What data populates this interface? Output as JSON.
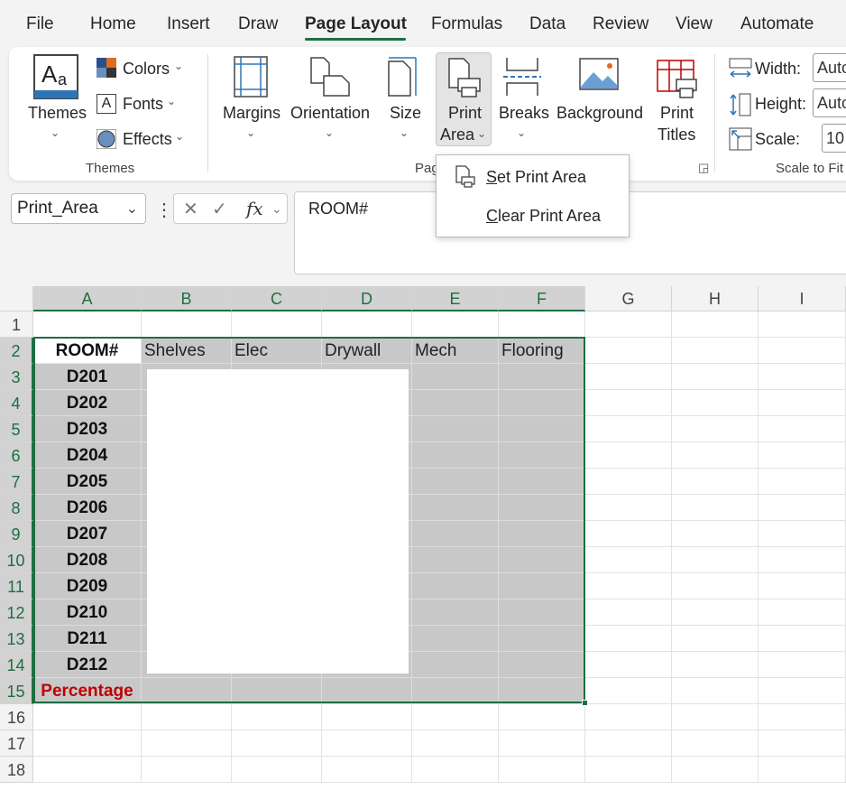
{
  "menu": {
    "tabs": [
      "File",
      "Home",
      "Insert",
      "Draw",
      "Page Layout",
      "Formulas",
      "Data",
      "Review",
      "View",
      "Automate"
    ],
    "active_tab": "Page Layout"
  },
  "ribbon": {
    "themes_group": {
      "themes_label": "Themes",
      "colors_label": "Colors",
      "fonts_label": "Fonts",
      "effects_label": "Effects",
      "group_label": "Themes"
    },
    "page_setup_group": {
      "margins_label": "Margins",
      "orientation_label": "Orientation",
      "size_label": "Size",
      "print_area_line1": "Print",
      "print_area_line2": "Area",
      "breaks_label": "Breaks",
      "background_label": "Background",
      "print_titles_line1": "Print",
      "print_titles_line2": "Titles",
      "group_label_visible": "Pag"
    },
    "scale_group": {
      "width_label": "Width:",
      "width_value": "Auto",
      "height_label": "Height:",
      "height_value": "Auto",
      "scale_label": "Scale:",
      "scale_value": "10",
      "group_label": "Scale to Fit"
    }
  },
  "dropdown": {
    "items": [
      {
        "accel": "S",
        "rest": "et Print Area"
      },
      {
        "accel": "C",
        "rest": "lear Print Area"
      }
    ]
  },
  "formula_bar": {
    "name_box": "Print_Area",
    "fx": "fx",
    "content": "ROOM#"
  },
  "sheet": {
    "columns": [
      "A",
      "B",
      "C",
      "D",
      "E",
      "F",
      "G",
      "H",
      "I"
    ],
    "rows": [
      "1",
      "2",
      "3",
      "4",
      "5",
      "6",
      "7",
      "8",
      "9",
      "10",
      "11",
      "12",
      "13",
      "14",
      "15",
      "16",
      "17",
      "18"
    ],
    "headers": [
      "ROOM#",
      "Shelves",
      "Elec",
      "Drywall",
      "Mech",
      "Flooring"
    ],
    "rooms": [
      "D201",
      "D202",
      "D203",
      "D204",
      "D205",
      "D206",
      "D207",
      "D208",
      "D209",
      "D210",
      "D211",
      "D212"
    ],
    "footer_label": "Percentage",
    "colors": {
      "selection": "#1e6e41",
      "percentage": "#c00000",
      "fill": "#c8c8c8"
    }
  }
}
